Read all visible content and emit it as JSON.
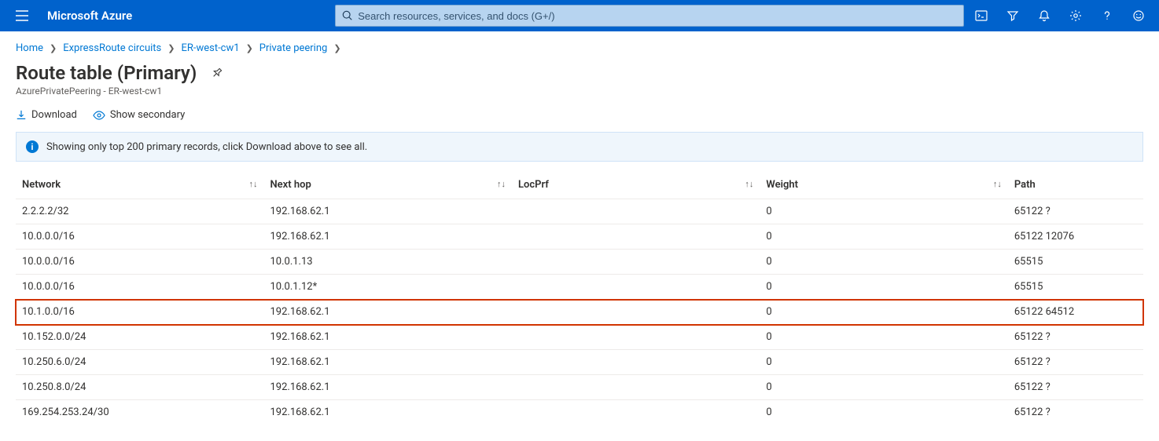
{
  "topbar": {
    "brand": "Microsoft Azure",
    "search_placeholder": "Search resources, services, and docs (G+/)"
  },
  "breadcrumb": {
    "items": [
      "Home",
      "ExpressRoute circuits",
      "ER-west-cw1",
      "Private peering"
    ]
  },
  "page": {
    "title": "Route table (Primary)",
    "subtitle": "AzurePrivatePeering - ER-west-cw1"
  },
  "commands": {
    "download": "Download",
    "show_secondary": "Show secondary"
  },
  "banner": {
    "text": "Showing only top 200 primary records, click Download above to see all."
  },
  "table": {
    "columns": {
      "network": "Network",
      "next_hop": "Next hop",
      "loc_prf": "LocPrf",
      "weight": "Weight",
      "path": "Path"
    },
    "rows": [
      {
        "network": "2.2.2.2/32",
        "next_hop": "192.168.62.1",
        "loc_prf": "",
        "weight": "0",
        "path": "65122 ?",
        "highlight": false
      },
      {
        "network": "10.0.0.0/16",
        "next_hop": "192.168.62.1",
        "loc_prf": "",
        "weight": "0",
        "path": "65122 12076",
        "highlight": false
      },
      {
        "network": "10.0.0.0/16",
        "next_hop": "10.0.1.13",
        "loc_prf": "",
        "weight": "0",
        "path": "65515",
        "highlight": false
      },
      {
        "network": "10.0.0.0/16",
        "next_hop": "10.0.1.12*",
        "loc_prf": "",
        "weight": "0",
        "path": "65515",
        "highlight": false
      },
      {
        "network": "10.1.0.0/16",
        "next_hop": "192.168.62.1",
        "loc_prf": "",
        "weight": "0",
        "path": "65122 64512",
        "highlight": true
      },
      {
        "network": "10.152.0.0/24",
        "next_hop": "192.168.62.1",
        "loc_prf": "",
        "weight": "0",
        "path": "65122 ?",
        "highlight": false
      },
      {
        "network": "10.250.6.0/24",
        "next_hop": "192.168.62.1",
        "loc_prf": "",
        "weight": "0",
        "path": "65122 ?",
        "highlight": false
      },
      {
        "network": "10.250.8.0/24",
        "next_hop": "192.168.62.1",
        "loc_prf": "",
        "weight": "0",
        "path": "65122 ?",
        "highlight": false
      },
      {
        "network": "169.254.253.24/30",
        "next_hop": "192.168.62.1",
        "loc_prf": "",
        "weight": "0",
        "path": "65122 ?",
        "highlight": false
      }
    ]
  }
}
